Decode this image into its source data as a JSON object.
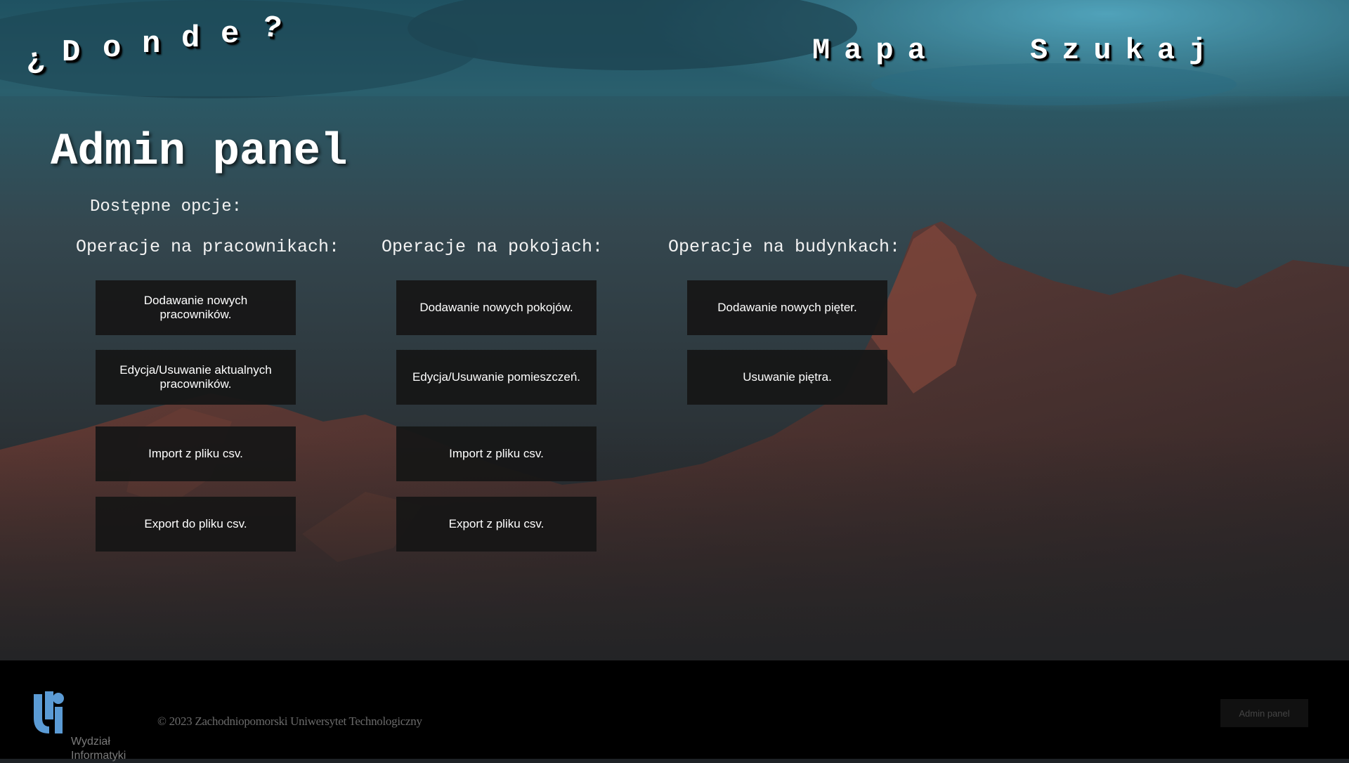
{
  "header": {
    "logo_chars": [
      "¿",
      "D",
      "o",
      "n",
      "d",
      "e",
      "?"
    ],
    "nav": {
      "mapa": "Mapa",
      "szukaj": "Szukaj"
    }
  },
  "main": {
    "title": "Admin panel",
    "subtitle": "Dostępne opcje:",
    "columns": {
      "employees": {
        "heading": "Operacje na pracownikach:",
        "buttons": [
          "Dodawanie nowych pracowników.",
          "Edycja/Usuwanie aktualnych pracowników.",
          "Import z pliku csv.",
          "Export do pliku csv."
        ]
      },
      "rooms": {
        "heading": "Operacje na pokojach:",
        "buttons": [
          "Dodawanie nowych pokojów.",
          "Edycja/Usuwanie pomieszczeń.",
          "Import z pliku csv.",
          "Export z pliku csv."
        ]
      },
      "buildings": {
        "heading": "Operacje na budynkach:",
        "buttons": [
          "Dodawanie nowych pięter.",
          "Usuwanie piętra."
        ]
      }
    }
  },
  "footer": {
    "logo_text": "Wydział Informatyki",
    "copyright": "© 2023 Zachodniopomorski Uniwersytet Technologiczny",
    "admin_button": "Admin panel"
  },
  "colors": {
    "sky": "#2f7a90",
    "mountain": "#4a2e2a",
    "button_bg": "#161616",
    "footer_bg": "#000000",
    "logo_blue": "#5b9bd5"
  }
}
